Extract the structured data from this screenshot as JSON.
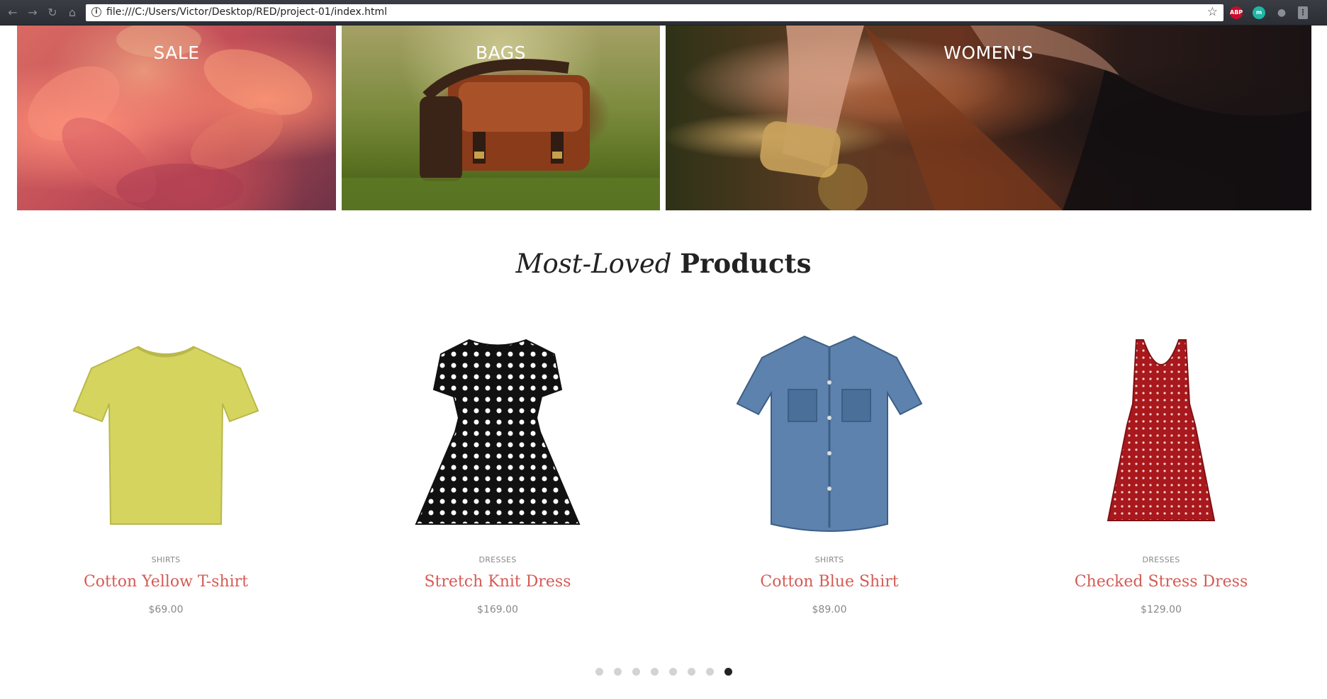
{
  "browser": {
    "url": "file:///C:/Users/Victor/Desktop/RED/project-01/index.html",
    "icons": [
      "back-icon",
      "forward-icon",
      "reload-icon",
      "home-icon",
      "info-icon",
      "star-icon"
    ],
    "extensions": [
      {
        "name": "adblock-plus-icon",
        "label": "ABP",
        "color": "#c70d2c"
      },
      {
        "name": "m-extension-icon",
        "label": "m",
        "color": "#1fb6a6"
      },
      {
        "name": "profile-icon",
        "label": "",
        "color": "#6a6d73"
      },
      {
        "name": "menu-icon",
        "label": "",
        "color": "#8a8d93"
      }
    ]
  },
  "banners": [
    {
      "label": "SALE"
    },
    {
      "label": "BAGS"
    },
    {
      "label": "WOMEN'S"
    }
  ],
  "section": {
    "title_italic": "Most-Loved",
    "title_bold": "Products"
  },
  "products": [
    {
      "category": "SHIRTS",
      "name": "Cotton Yellow T-shirt",
      "price": "$69.00",
      "image_icon": "yellow-tshirt-image",
      "color": "#d4d45f"
    },
    {
      "category": "DRESSES",
      "name": "Stretch Knit Dress",
      "price": "$169.00",
      "image_icon": "polka-dot-dress-image",
      "color": "#111111"
    },
    {
      "category": "SHIRTS",
      "name": "Cotton Blue Shirt",
      "price": "$89.00",
      "image_icon": "denim-shirt-image",
      "color": "#5c82ad"
    },
    {
      "category": "DRESSES",
      "name": "Checked Stress Dress",
      "price": "$129.00",
      "image_icon": "red-dress-image",
      "color": "#a8181c"
    }
  ],
  "carousel": {
    "dot_count": 8,
    "active_index": 7
  },
  "colors": {
    "accent": "#d55b55",
    "muted_text": "#888888",
    "heading": "#222222"
  }
}
